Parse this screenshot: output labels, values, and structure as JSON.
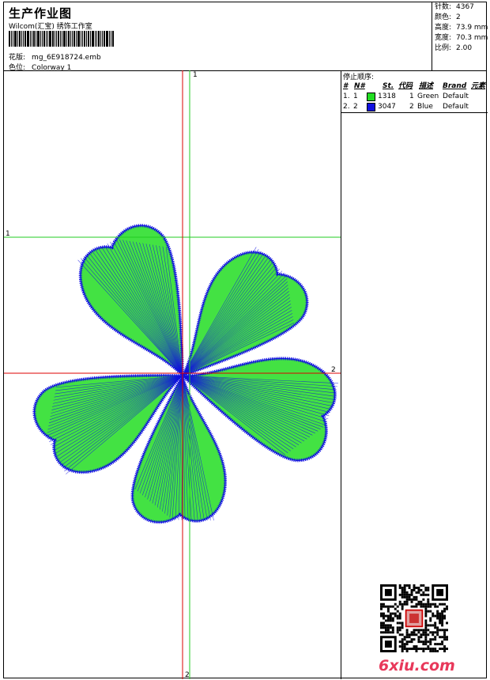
{
  "header": {
    "title": "生产作业图",
    "studio": "Wilcom(汇宝) 绣饰工作室",
    "design_label": "花版:",
    "design_value": "mg_6E918724.emb",
    "colorway_label": "色位:",
    "colorway_value": "Colorway 1"
  },
  "stats": [
    {
      "label": "针数:",
      "value": "4367"
    },
    {
      "label": "颜色:",
      "value": "2"
    },
    {
      "label": "高度:",
      "value": "73.9 mm"
    },
    {
      "label": "宽度:",
      "value": "70.3 mm"
    },
    {
      "label": "比例:",
      "value": "2.00"
    }
  ],
  "stop_sequence": {
    "title": "停止顺序:",
    "headers": {
      "hash": "#",
      "num": "N#",
      "st": "St.",
      "code": "代码",
      "desc": "描述",
      "brand": "Brand",
      "elem": "元素"
    },
    "rows": [
      {
        "hash": "1.",
        "num": "1",
        "color": "#22dd22",
        "st": "1318",
        "code": "1",
        "desc": "Green",
        "brand": "Default"
      },
      {
        "hash": "2.",
        "num": "2",
        "color": "#1010e0",
        "st": "3047",
        "code": "2",
        "desc": "Blue",
        "brand": "Default"
      }
    ]
  },
  "axes": {
    "green_label_top": "1",
    "green_label_left": "1",
    "red_label_right": "2",
    "red_label_bottom": "2"
  },
  "colors": {
    "green_thread": "#22dd22",
    "blue_thread": "#1010e0",
    "green_axis": "#22cc22",
    "red_axis": "#dd0000"
  },
  "watermark": "6xiu.com",
  "icons": {
    "qr": "qr-code-icon",
    "seal": "red-seal-icon"
  }
}
